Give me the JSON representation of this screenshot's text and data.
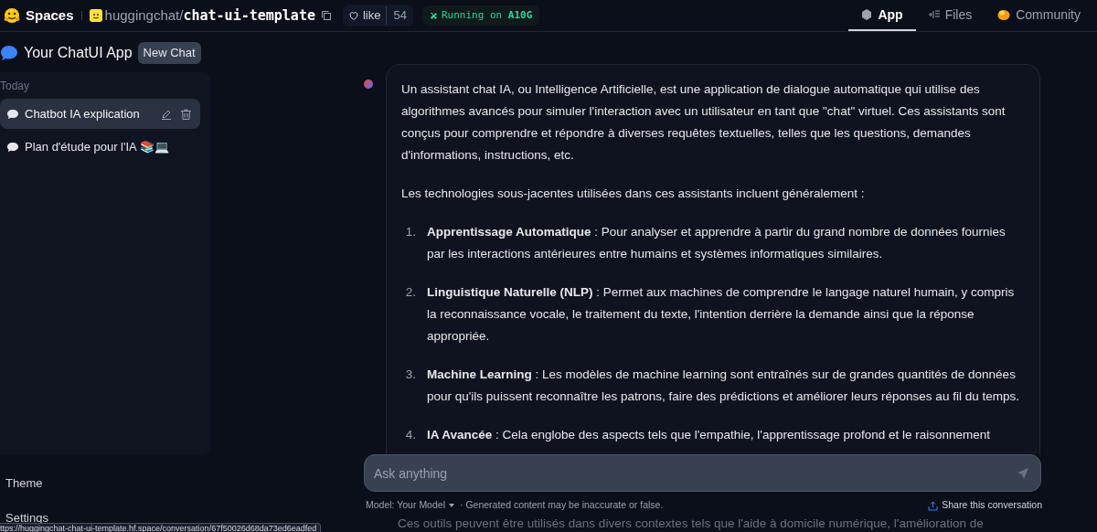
{
  "topbar": {
    "brand": "Spaces",
    "owner": "huggingchat",
    "separator": "/",
    "repo": "chat-ui-template",
    "like_label": "like",
    "like_count": "54",
    "status_prefix": "Running on",
    "status_hardware": "A10G",
    "tabs": [
      {
        "label": "App",
        "kind": "app",
        "selected": true
      },
      {
        "label": "Files",
        "kind": "files",
        "selected": false
      },
      {
        "label": "Community",
        "kind": "community",
        "selected": false
      }
    ]
  },
  "app": {
    "title": "Your ChatUI App",
    "new_chat": "New Chat"
  },
  "sidebar": {
    "group": "Today",
    "items": [
      {
        "label": "Chatbot IA explication",
        "selected": true
      },
      {
        "label": "Plan d'étude pour l'IA 📚💻",
        "selected": false
      }
    ],
    "footer": [
      "Theme",
      "Settings"
    ]
  },
  "message": {
    "paragraphs": [
      "Un assistant chat IA, ou Intelligence Artificielle, est une application de dialogue automatique qui utilise des algorithmes avancés pour simuler l'interaction avec un utilisateur en tant que \"chat\" virtuel. Ces assistants sont conçus pour comprendre et répondre à diverses requêtes textuelles, telles que les questions, demandes d'informations, instructions, etc.",
      "Les technologies sous-jacentes utilisées dans ces assistants incluent généralement :"
    ],
    "list": [
      {
        "number": "1.",
        "text": "**Apprentissage Automatique** : Pour analyser et apprendre à partir du grand nombre de données fournies par les interactions antérieures entre humains et systèmes informatiques similaires."
      },
      {
        "number": "2.",
        "text": "**Linguistique Naturelle (NLP)** : Permet aux machines de comprendre le langage naturel humain, y compris la reconnaissance vocale, le traitement du texte, l'intention derrière la demande ainsi que la réponse appropriée."
      },
      {
        "number": "3.",
        "text": "**Machine Learning** : Les modèles de machine learning sont entraînés sur de grandes quantités de données pour qu'ils puissent reconnaître les patrons, faire des prédictions et améliorer leurs réponses au fil du temps."
      },
      {
        "number": "4.",
        "text": "**IA Avancée** : Cela englobe des aspects tels que l'empathie, l'apprentissage profond et le raisonnement"
      }
    ],
    "trailing": "Ces outils peuvent être utilisés dans divers contextes tels que l'aide à domicile numérique, l'amélioration de"
  },
  "composer": {
    "placeholder": "Ask anything",
    "model": "Model: Your Model",
    "disclaimer": "· Generated content may be inaccurate or false.",
    "share": "Share this conversation"
  },
  "status_bar": "ttps://huggingchat-chat-ui-template.hf.space/conversation/67f50026d68da73ed6eadfed"
}
